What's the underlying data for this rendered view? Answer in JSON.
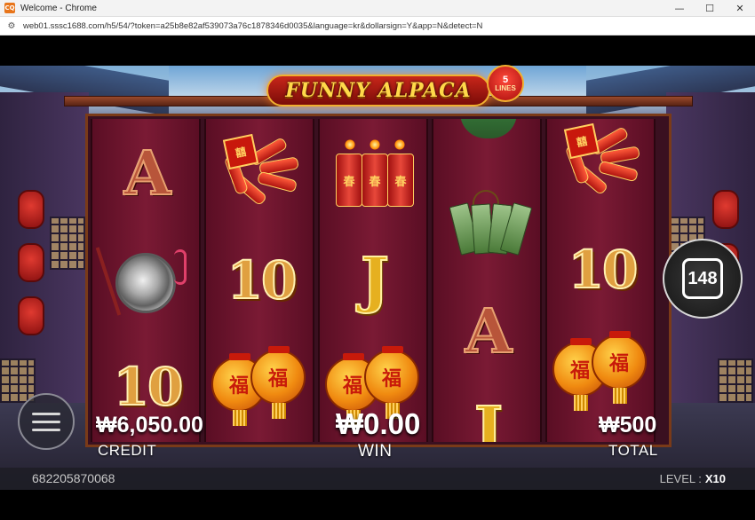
{
  "window": {
    "title": "Welcome - Chrome",
    "app_icon_text": "CQ",
    "controls": [
      "—",
      "☐",
      "✕"
    ]
  },
  "address": {
    "url": "web01.sssc1688.com/h5/54/?token=a25b8e82af539073a76c1878346d0035&language=kr&dollarsign=Y&app=N&detect=N"
  },
  "game": {
    "logo": "FUNNY ALPACA",
    "lines_badge": {
      "number": "5",
      "label": "LINES"
    },
    "reels": [
      [
        "A",
        "gong",
        "10"
      ],
      [
        "firecracker",
        "10",
        "lanterns"
      ],
      [
        "crackers",
        "J",
        "lanterns"
      ],
      [
        "jade",
        "A",
        "J"
      ],
      [
        "firecracker",
        "10",
        "lanterns"
      ]
    ],
    "symbol_chars": {
      "firecracker_label": "囍",
      "cracker_tubes": [
        "春",
        "春",
        "春"
      ],
      "lantern_char": "福"
    },
    "side_badge": "148",
    "credit": {
      "value": "₩6,050.00",
      "label": "CREDIT"
    },
    "win": {
      "value": "₩0.00",
      "label": "WIN"
    },
    "total": {
      "value": "₩500",
      "label": "TOTAL"
    },
    "account_id": "682205870068",
    "level": {
      "label": "LEVEL :",
      "value": "X10"
    }
  }
}
